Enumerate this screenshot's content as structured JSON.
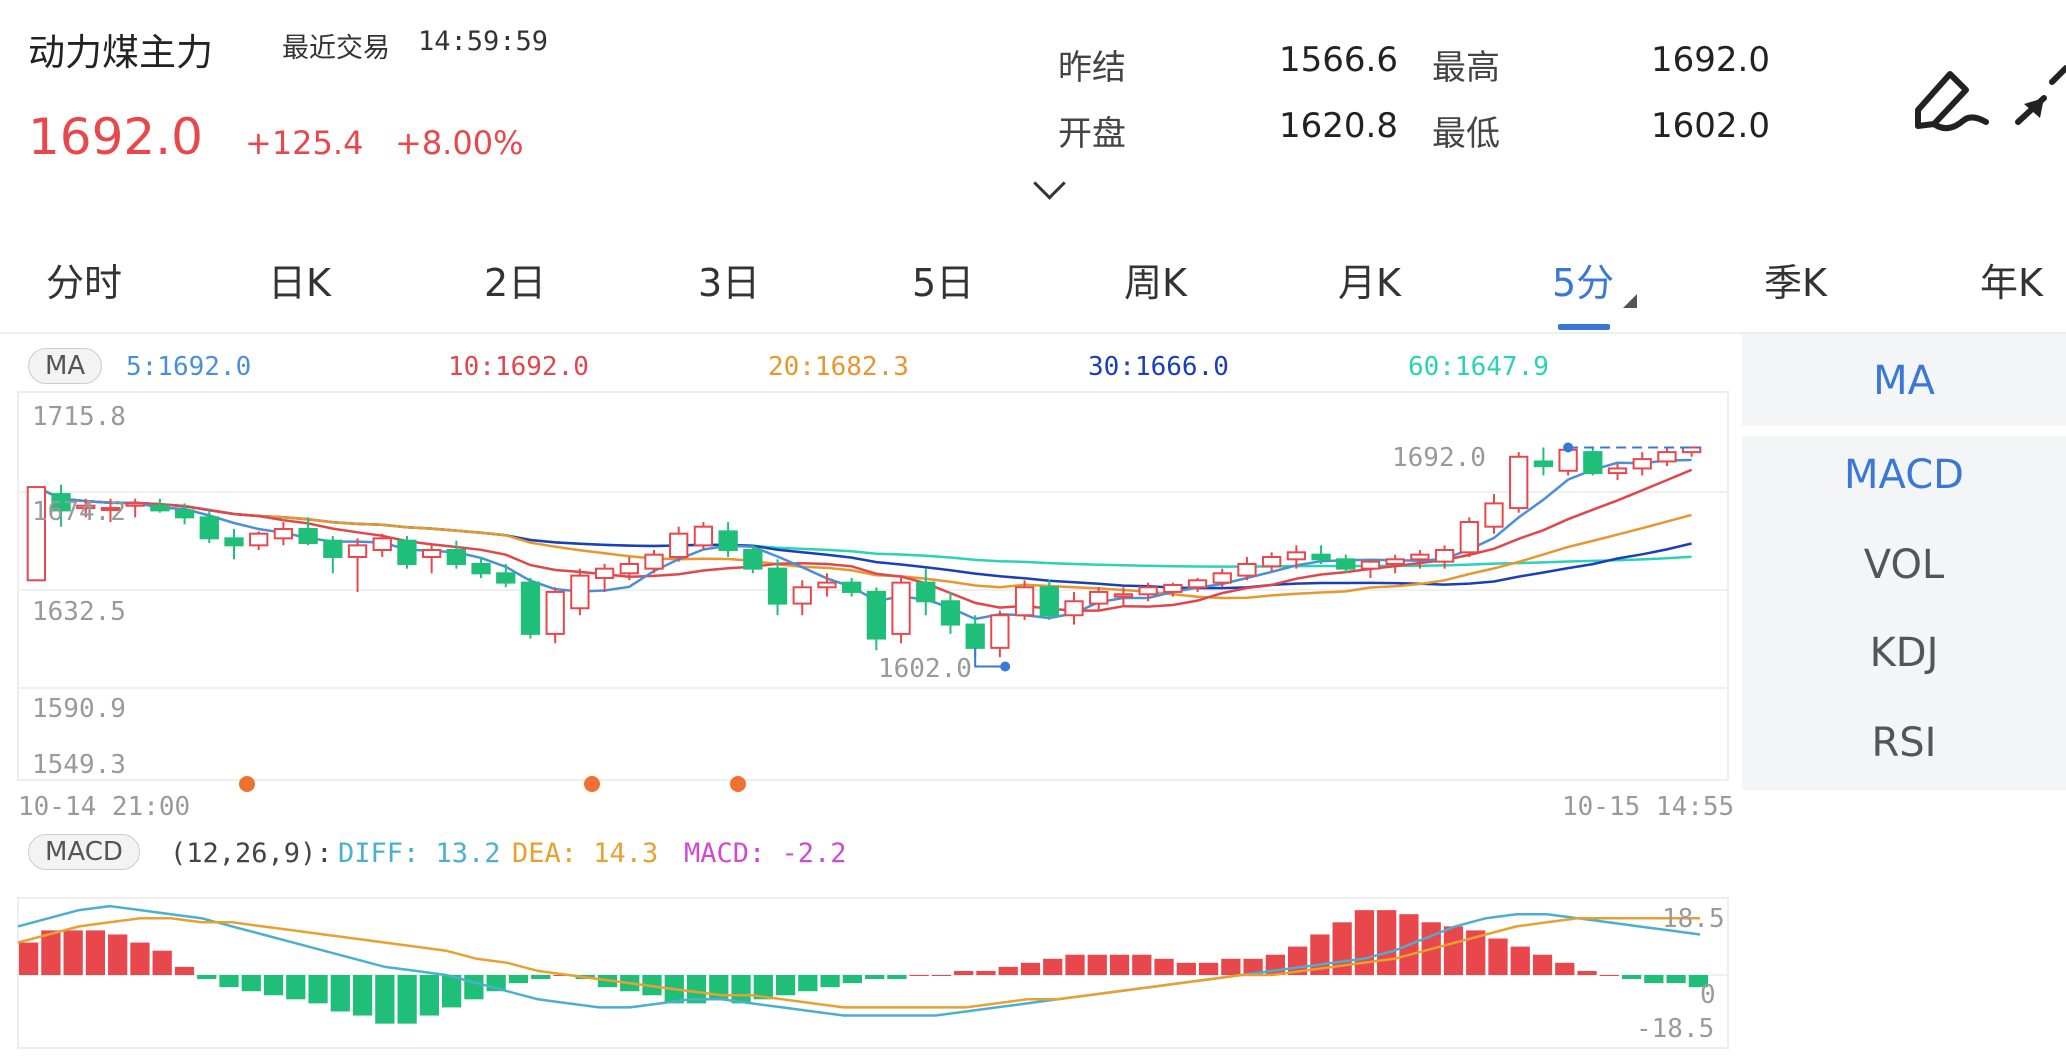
{
  "header": {
    "title": "动力煤主力",
    "last_trade_label": "最近交易",
    "last_trade_time": "14:59:59",
    "price": "1692.0",
    "change": "+125.4",
    "change_pct": "+8.00%"
  },
  "quote": {
    "prev_settle_label": "昨结",
    "prev_settle": "1566.6",
    "high_label": "最高",
    "high": "1692.0",
    "open_label": "开盘",
    "open": "1620.8",
    "low_label": "最低",
    "low": "1602.0"
  },
  "tabs": [
    "分时",
    "日K",
    "2日",
    "3日",
    "5日",
    "周K",
    "月K",
    "5分",
    "季K",
    "年K"
  ],
  "active_tab": "5分",
  "ma_legend": {
    "pill": "MA",
    "ma5": "5:1692.0",
    "ma10": "10:1692.0",
    "ma20": "20:1682.3",
    "ma30": "30:1666.0",
    "ma60": "60:1647.9"
  },
  "price_axis": [
    "1715.8",
    "1674.2",
    "1632.5",
    "1590.9",
    "1549.3"
  ],
  "time_axis": {
    "start": "10-14 21:00",
    "end": "10-15 14:55"
  },
  "annotations": {
    "high": "1692.0",
    "low": "1602.0"
  },
  "macd_legend": {
    "pill": "MACD",
    "params": "(12,26,9):",
    "diff": "DIFF: 13.2",
    "dea": "DEA: 14.3",
    "macd": "MACD: -2.2"
  },
  "macd_axis": [
    "18.5",
    "0",
    "-18.5"
  ],
  "side_panel": [
    "MA",
    "MACD",
    "VOL",
    "KDJ",
    "RSI"
  ],
  "icons": [
    "pen-icon",
    "collapse-icon",
    "chevron-down-icon"
  ],
  "colors": {
    "up": "#e8474c",
    "down": "#1fbf7a",
    "accent": "#3a78d8",
    "ma5": "#4a90d9",
    "ma10": "#e0474c",
    "ma20": "#e8962e",
    "ma30": "#1a3fb8",
    "ma60": "#2ad3b6",
    "diff": "#4ab0d0",
    "dea": "#e8a030",
    "macd_text": "#d04ad0",
    "marker": "#f07030"
  },
  "chart_data": {
    "type": "candlestick",
    "ylim": [
      1549.3,
      1715.8
    ],
    "candles": [
      [
        1635,
        1675,
        1635,
        1675
      ],
      [
        1672,
        1676,
        1658,
        1665
      ],
      [
        1666,
        1670,
        1662,
        1667
      ],
      [
        1666,
        1670,
        1660,
        1666
      ],
      [
        1667,
        1670,
        1662,
        1668
      ],
      [
        1667,
        1670,
        1664,
        1665
      ],
      [
        1665,
        1668,
        1659,
        1662
      ],
      [
        1662,
        1665,
        1651,
        1653
      ],
      [
        1653,
        1657,
        1644,
        1650
      ],
      [
        1650,
        1656,
        1648,
        1655
      ],
      [
        1653,
        1660,
        1650,
        1657
      ],
      [
        1657,
        1662,
        1650,
        1651
      ],
      [
        1652,
        1654,
        1638,
        1645
      ],
      [
        1645,
        1653,
        1630,
        1650
      ],
      [
        1648,
        1655,
        1645,
        1653
      ],
      [
        1652,
        1654,
        1640,
        1642
      ],
      [
        1645,
        1650,
        1638,
        1648
      ],
      [
        1648,
        1652,
        1640,
        1642
      ],
      [
        1642,
        1645,
        1636,
        1638
      ],
      [
        1638,
        1642,
        1632,
        1634
      ],
      [
        1634,
        1636,
        1610,
        1612
      ],
      [
        1612,
        1632,
        1608,
        1630
      ],
      [
        1623,
        1640,
        1620,
        1637
      ],
      [
        1636,
        1642,
        1630,
        1640
      ],
      [
        1638,
        1645,
        1635,
        1642
      ],
      [
        1640,
        1648,
        1638,
        1646
      ],
      [
        1645,
        1658,
        1643,
        1655
      ],
      [
        1650,
        1660,
        1648,
        1658
      ],
      [
        1656,
        1660,
        1645,
        1648
      ],
      [
        1648,
        1650,
        1638,
        1640
      ],
      [
        1640,
        1644,
        1620,
        1625
      ],
      [
        1625,
        1635,
        1620,
        1632
      ],
      [
        1632,
        1638,
        1628,
        1634
      ],
      [
        1634,
        1636,
        1628,
        1630
      ],
      [
        1630,
        1632,
        1605,
        1610
      ],
      [
        1612,
        1636,
        1608,
        1634
      ],
      [
        1634,
        1640,
        1620,
        1626
      ],
      [
        1626,
        1630,
        1612,
        1616
      ],
      [
        1616,
        1620,
        1602,
        1606
      ],
      [
        1606,
        1622,
        1602,
        1620
      ],
      [
        1620,
        1635,
        1618,
        1632
      ],
      [
        1632,
        1635,
        1618,
        1620
      ],
      [
        1620,
        1630,
        1616,
        1626
      ],
      [
        1625,
        1632,
        1622,
        1630
      ],
      [
        1628,
        1632,
        1624,
        1629
      ],
      [
        1629,
        1634,
        1626,
        1632
      ],
      [
        1630,
        1634,
        1628,
        1633
      ],
      [
        1632,
        1636,
        1630,
        1635
      ],
      [
        1634,
        1640,
        1632,
        1638
      ],
      [
        1637,
        1645,
        1635,
        1642
      ],
      [
        1641,
        1647,
        1639,
        1645
      ],
      [
        1644,
        1650,
        1640,
        1647
      ],
      [
        1646,
        1650,
        1642,
        1644
      ],
      [
        1644,
        1646,
        1638,
        1640
      ],
      [
        1640,
        1644,
        1636,
        1643
      ],
      [
        1642,
        1646,
        1638,
        1644
      ],
      [
        1644,
        1648,
        1640,
        1646
      ],
      [
        1643,
        1650,
        1640,
        1648
      ],
      [
        1647,
        1662,
        1645,
        1660
      ],
      [
        1658,
        1672,
        1655,
        1668
      ],
      [
        1666,
        1690,
        1664,
        1688
      ],
      [
        1686,
        1692,
        1680,
        1684
      ],
      [
        1682,
        1692,
        1680,
        1691
      ],
      [
        1690,
        1692,
        1680,
        1681
      ],
      [
        1681,
        1685,
        1678,
        1683
      ],
      [
        1683,
        1690,
        1680,
        1687
      ],
      [
        1686,
        1692,
        1684,
        1690
      ],
      [
        1690,
        1692,
        1688,
        1692
      ]
    ],
    "macd_hist": [
      8,
      11,
      11,
      11,
      10,
      8,
      6,
      2,
      -1,
      -3,
      -4,
      -5,
      -6,
      -7,
      -9,
      -10,
      -12,
      -12,
      -10,
      -8,
      -6,
      -4,
      -2,
      -1,
      0,
      -1,
      -3,
      -4,
      -5,
      -7,
      -7,
      -6,
      -7,
      -6,
      -5,
      -4,
      -3,
      -2,
      -1,
      -1,
      0,
      0,
      1,
      1,
      2,
      3,
      4,
      5,
      5,
      5,
      5,
      4,
      3,
      3,
      4,
      4,
      5,
      7,
      10,
      13,
      16,
      16,
      15,
      13,
      12,
      11,
      9,
      7,
      5,
      3,
      1,
      0,
      -1,
      -2,
      -2,
      -3
    ],
    "series": [
      {
        "name": "DIFF",
        "values": [
          12,
          14,
          16,
          17,
          16,
          15,
          14,
          12,
          10,
          8,
          6,
          4,
          2,
          1,
          0,
          -2,
          -4,
          -6,
          -7,
          -8,
          -8,
          -7,
          -6,
          -6,
          -7,
          -8,
          -9,
          -10,
          -10,
          -10,
          -10,
          -9,
          -8,
          -7,
          -6,
          -5,
          -4,
          -3,
          -2,
          -1,
          0,
          1,
          2,
          3,
          4,
          6,
          9,
          12,
          14,
          15,
          15,
          14,
          13,
          12,
          11,
          10
        ]
      },
      {
        "name": "DEA",
        "values": [
          8,
          10,
          12,
          13,
          14,
          14,
          13,
          13,
          12,
          11,
          10,
          9,
          8,
          7,
          6,
          4,
          3,
          1,
          0,
          -1,
          -2,
          -3,
          -4,
          -5,
          -5,
          -6,
          -7,
          -8,
          -8,
          -8,
          -8,
          -8,
          -7,
          -6,
          -6,
          -5,
          -4,
          -3,
          -2,
          -1,
          0,
          0,
          1,
          2,
          3,
          4,
          6,
          8,
          10,
          12,
          13,
          14,
          14,
          14,
          14,
          14
        ]
      }
    ]
  }
}
